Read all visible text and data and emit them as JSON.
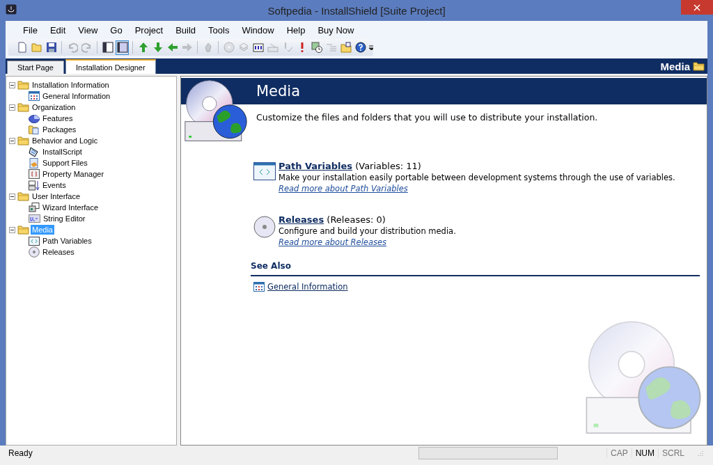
{
  "window": {
    "title": "Softpedia - InstallShield [Suite Project]"
  },
  "menu": [
    "File",
    "Edit",
    "View",
    "Go",
    "Project",
    "Build",
    "Tools",
    "Window",
    "Help",
    "Buy Now"
  ],
  "toolbar": [
    {
      "kind": "new",
      "disabled": false,
      "selected": false
    },
    {
      "kind": "open",
      "disabled": false,
      "selected": false
    },
    {
      "kind": "save",
      "disabled": false,
      "selected": false
    },
    {
      "kind": "sep"
    },
    {
      "kind": "undo",
      "disabled": true,
      "selected": false
    },
    {
      "kind": "redo",
      "disabled": true,
      "selected": false
    },
    {
      "kind": "sep"
    },
    {
      "kind": "pane-left",
      "disabled": false,
      "selected": false
    },
    {
      "kind": "pane-right",
      "disabled": false,
      "selected": true
    },
    {
      "kind": "sep"
    },
    {
      "kind": "up",
      "disabled": false,
      "selected": false
    },
    {
      "kind": "down",
      "disabled": false,
      "selected": false
    },
    {
      "kind": "left",
      "disabled": false,
      "selected": false
    },
    {
      "kind": "right",
      "disabled": true,
      "selected": false
    },
    {
      "kind": "sep"
    },
    {
      "kind": "hand",
      "disabled": true,
      "selected": false
    },
    {
      "kind": "sep"
    },
    {
      "kind": "disc",
      "disabled": true,
      "selected": false
    },
    {
      "kind": "stack",
      "disabled": true,
      "selected": false
    },
    {
      "kind": "grid",
      "disabled": false,
      "selected": false
    },
    {
      "kind": "keyboard",
      "disabled": true,
      "selected": false
    },
    {
      "kind": "check",
      "disabled": true,
      "selected": false
    },
    {
      "kind": "alert",
      "disabled": false,
      "selected": false
    },
    {
      "kind": "clock",
      "disabled": false,
      "selected": false
    },
    {
      "kind": "list",
      "disabled": true,
      "selected": false
    },
    {
      "kind": "folder",
      "disabled": false,
      "selected": false
    },
    {
      "kind": "help",
      "disabled": false,
      "selected": false
    }
  ],
  "tabs": [
    {
      "label": "Start Page",
      "selected": false
    },
    {
      "label": "Installation Designer",
      "selected": true
    }
  ],
  "view_header": {
    "title": "Media"
  },
  "tree": [
    {
      "label": "Installation Information",
      "kind": "folder",
      "expanded": true,
      "selected": false,
      "children": [
        {
          "label": "General Information",
          "kind": "grid",
          "selected": false
        }
      ]
    },
    {
      "label": "Organization",
      "kind": "folder",
      "expanded": true,
      "selected": false,
      "children": [
        {
          "label": "Features",
          "kind": "pie",
          "selected": false
        },
        {
          "label": "Packages",
          "kind": "package",
          "selected": false
        }
      ]
    },
    {
      "label": "Behavior and Logic",
      "kind": "folder",
      "expanded": true,
      "selected": false,
      "children": [
        {
          "label": "InstallScript",
          "kind": "script",
          "selected": false
        },
        {
          "label": "Support Files",
          "kind": "files",
          "selected": false
        },
        {
          "label": "Property Manager",
          "kind": "property",
          "selected": false
        },
        {
          "label": "Events",
          "kind": "events",
          "selected": false
        }
      ]
    },
    {
      "label": "User Interface",
      "kind": "folder",
      "expanded": true,
      "selected": false,
      "children": [
        {
          "label": "Wizard Interface",
          "kind": "windows",
          "selected": false
        },
        {
          "label": "String Editor",
          "kind": "abc",
          "selected": false
        }
      ]
    },
    {
      "label": "Media",
      "kind": "folder",
      "expanded": true,
      "selected": true,
      "children": [
        {
          "label": "Path Variables",
          "kind": "code",
          "selected": false
        },
        {
          "label": "Releases",
          "kind": "disc",
          "selected": false
        }
      ]
    }
  ],
  "page": {
    "title": "Media",
    "description": "Customize the files and folders that you will use to distribute your installation.",
    "sections": [
      {
        "kind": "code",
        "link": "Path Variables",
        "count": "(Variables: 11)",
        "description": "Make your installation easily portable between development systems through the use of variables.",
        "more": "Read more about Path Variables"
      },
      {
        "kind": "disc",
        "link": "Releases",
        "count": "(Releases: 0)",
        "description": "Configure and build your distribution media.",
        "more": "Read more about Releases"
      }
    ],
    "see_also": {
      "heading": "See Also",
      "links": [
        "General Information"
      ]
    }
  },
  "status_bar": {
    "text": "Ready",
    "progress": {
      "level": 0
    },
    "indicators": [
      {
        "label": "CAP",
        "on": false
      },
      {
        "label": "NUM",
        "on": true
      },
      {
        "label": "SCRL",
        "on": false
      }
    ]
  }
}
